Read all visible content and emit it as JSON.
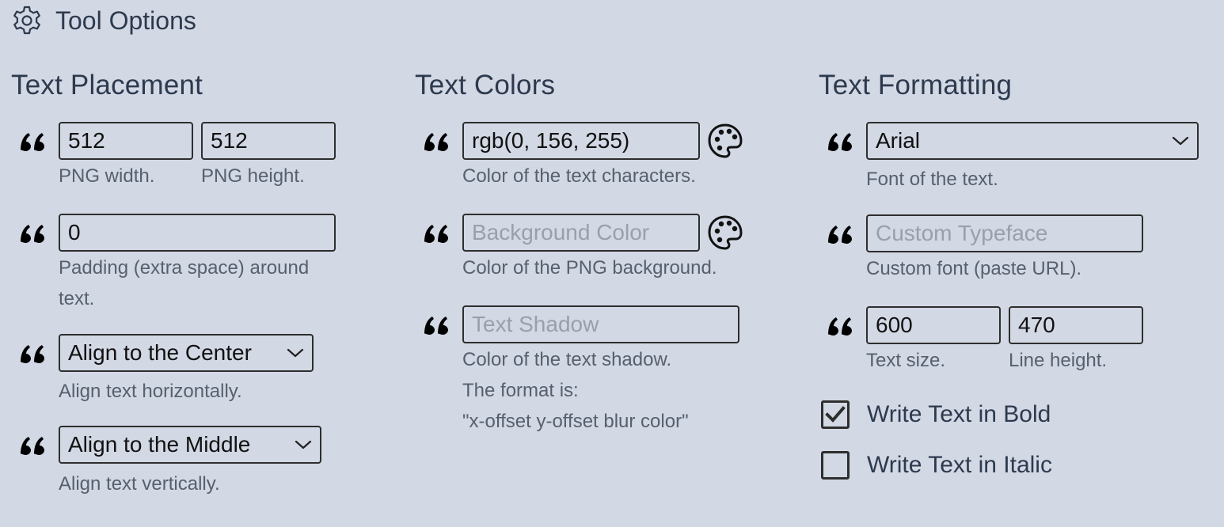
{
  "header": {
    "title": "Tool Options",
    "icon": "gear-icon"
  },
  "placement": {
    "title": "Text Placement",
    "width": {
      "value": "512",
      "hint": "PNG width."
    },
    "height": {
      "value": "512",
      "hint": "PNG height."
    },
    "padding": {
      "value": "0",
      "hint_line1": "Padding (extra space) around",
      "hint_line2": "text."
    },
    "halign": {
      "value": "Align to the Center",
      "hint": "Align text horizontally."
    },
    "valign": {
      "value": "Align to the Middle",
      "hint": "Align text vertically."
    }
  },
  "colors": {
    "title": "Text Colors",
    "text_color": {
      "value": "rgb(0, 156, 255)",
      "hint": "Color of the text characters."
    },
    "bg_color": {
      "placeholder": "Background Color",
      "hint": "Color of the PNG background."
    },
    "shadow": {
      "placeholder": "Text Shadow",
      "hint_line1": "Color of the text shadow.",
      "hint_line2": "The format is:",
      "hint_line3": "\"x-offset y-offset blur color\""
    }
  },
  "formatting": {
    "title": "Text Formatting",
    "font": {
      "value": "Arial",
      "hint": "Font of the text."
    },
    "custom_font": {
      "placeholder": "Custom Typeface",
      "hint": "Custom font (paste URL)."
    },
    "text_size": {
      "value": "600",
      "hint": "Text size."
    },
    "line_height": {
      "value": "470",
      "hint": "Line height."
    },
    "bold": {
      "label": "Write Text in Bold",
      "checked": true
    },
    "italic": {
      "label": "Write Text in Italic",
      "checked": false
    }
  },
  "theme": {
    "background": "#d2d8e4",
    "text": "#2d3a4e",
    "hint": "#56606e",
    "border": "#2e2e2e"
  }
}
